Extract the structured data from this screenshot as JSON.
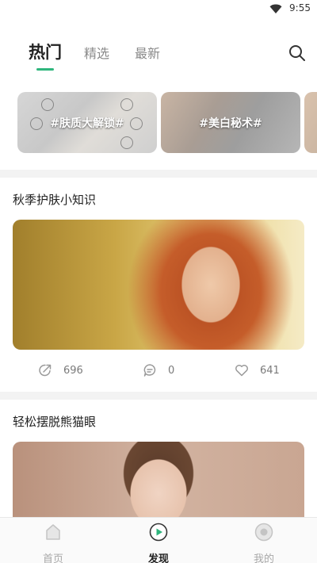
{
  "status_bar": {
    "time": "9:55"
  },
  "tabs": [
    {
      "label": "热门"
    },
    {
      "label": "精选"
    },
    {
      "label": "最新"
    }
  ],
  "topics": [
    {
      "label": "#肤质大解锁#"
    },
    {
      "label": "#美白秘术#"
    }
  ],
  "posts": [
    {
      "title": "秋季护肤小知识",
      "shares": "696",
      "comments": "0",
      "likes": "641"
    },
    {
      "title": "轻松摆脱熊猫眼"
    }
  ],
  "bottom_nav": [
    {
      "label": "首页"
    },
    {
      "label": "发现"
    },
    {
      "label": "我的"
    }
  ],
  "colors": {
    "accent": "#2fb67d",
    "muted": "#a8a8a8"
  }
}
